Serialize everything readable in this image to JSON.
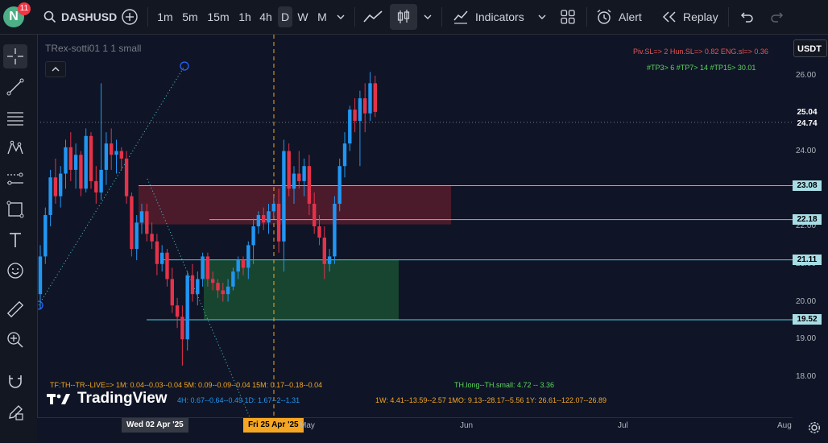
{
  "topbar": {
    "avatar_letter": "N",
    "notif_count": "11",
    "symbol": "DASHUSD",
    "timeframes": [
      "1m",
      "5m",
      "15m",
      "1h",
      "4h",
      "D",
      "W",
      "M"
    ],
    "active_timeframe": "D",
    "indicators_label": "Indicators",
    "alert_label": "Alert",
    "replay_label": "Replay"
  },
  "chart": {
    "indicator_title": "TRex-sotti01 1 1 small",
    "currency": "USDT",
    "top_info_1": "Piv.SL=> 2  Hun.SL=> 0.82  ENG.sl=> 0.36",
    "top_info_2": "#TP3> 6  #TP7> 14  #TP15> 30.01",
    "price_scale": [
      "26.00",
      "25.00",
      "24.00",
      "23.00",
      "22.00",
      "21.00",
      "20.00",
      "19.00",
      "18.00"
    ],
    "price_tags": [
      {
        "text": "25.04",
        "color": "#0f1526",
        "fg": "#ffffff"
      },
      {
        "text": "24.74",
        "color": "#0f1526",
        "fg": "#ffffff"
      },
      {
        "text": "23.08",
        "color": "#a8dde6",
        "fg": "#000000"
      },
      {
        "text": "22.18",
        "color": "#a8dde6",
        "fg": "#000000"
      },
      {
        "text": "21.11",
        "color": "#a8dde6",
        "fg": "#000000"
      },
      {
        "text": "19.52",
        "color": "#a8dde6",
        "fg": "#000000"
      }
    ],
    "time_labels": {
      "date_1": "Wed 02 Apr '25",
      "date_2": "Fri 25 Apr '25",
      "may": "May",
      "jun": "Jun",
      "jul": "Jul",
      "aug": "Aug"
    },
    "bottom_info": {
      "row1_a": "TF:TH--TR--LIVE=>  1M: 0.04--0.03--0.04   5M: 0.09--0.09--0.04   15M: 0.17--0.18--0.04",
      "row1_b": "TH.long--TH.small: 4.72 -- 3.36",
      "row2_a": "4H: 0.67--0.64--0.49   1D: 1.67--2--1.31",
      "row2_b": "1W: 4.41--13.59--2.57   1MO: 9.13--28.17--5.56   1Y: 26.61--122.07--26.89"
    },
    "watermark": "TradingView",
    "colors": {
      "bull": "#2196f3",
      "bear": "#e5324a",
      "level": "#4dd0e1",
      "orange": "#f5a623",
      "green_info": "#5cd65c",
      "red_info": "#ef5350"
    }
  },
  "chart_data": {
    "type": "candlestick",
    "candles": [
      [
        0,
        20.2,
        21.5,
        19.8,
        21.2
      ],
      [
        1,
        21.2,
        22.5,
        21.0,
        22.3
      ],
      [
        2,
        22.3,
        23.5,
        22.0,
        23.3
      ],
      [
        3,
        23.3,
        23.8,
        22.6,
        22.8
      ],
      [
        4,
        22.8,
        23.6,
        22.5,
        23.4
      ],
      [
        5,
        23.4,
        24.3,
        23.0,
        24.1
      ],
      [
        6,
        24.1,
        24.5,
        23.2,
        23.5
      ],
      [
        7,
        23.5,
        24.2,
        23.0,
        23.9
      ],
      [
        8,
        23.9,
        24.0,
        22.8,
        23.0
      ],
      [
        9,
        23.0,
        24.6,
        22.9,
        24.4
      ],
      [
        10,
        24.4,
        24.5,
        23.0,
        23.2
      ],
      [
        11,
        23.2,
        23.6,
        22.6,
        22.9
      ],
      [
        12,
        22.9,
        25.8,
        22.7,
        23.5
      ],
      [
        13,
        23.5,
        24.5,
        23.1,
        24.2
      ],
      [
        14,
        24.2,
        24.6,
        23.5,
        23.9
      ],
      [
        15,
        23.9,
        24.3,
        23.4,
        24.0
      ],
      [
        16,
        24.0,
        24.1,
        23.5,
        23.8
      ],
      [
        17,
        23.8,
        24.0,
        22.6,
        22.8
      ],
      [
        18,
        22.8,
        22.9,
        21.2,
        21.4
      ],
      [
        19,
        21.4,
        22.3,
        21.1,
        22.1
      ],
      [
        20,
        22.1,
        22.6,
        21.8,
        22.4
      ],
      [
        21,
        22.4,
        22.6,
        21.6,
        21.8
      ],
      [
        22,
        21.8,
        22.1,
        21.4,
        21.6
      ],
      [
        23,
        21.6,
        21.8,
        20.7,
        21.0
      ],
      [
        24,
        21.0,
        21.5,
        20.8,
        21.3
      ],
      [
        25,
        21.3,
        21.4,
        20.4,
        20.6
      ],
      [
        26,
        20.6,
        20.9,
        19.7,
        19.9
      ],
      [
        27,
        19.9,
        20.1,
        19.3,
        19.6
      ],
      [
        28,
        19.6,
        19.9,
        18.3,
        19.0
      ],
      [
        29,
        19.0,
        20.8,
        18.7,
        20.7
      ],
      [
        30,
        20.7,
        21.0,
        20.0,
        20.2
      ],
      [
        31,
        20.2,
        20.8,
        19.9,
        20.6
      ],
      [
        32,
        20.6,
        21.3,
        20.4,
        21.2
      ],
      [
        33,
        21.2,
        21.3,
        20.4,
        20.6
      ],
      [
        34,
        20.6,
        20.8,
        20.3,
        20.5
      ],
      [
        35,
        20.5,
        20.6,
        20.1,
        20.3
      ],
      [
        36,
        20.3,
        20.5,
        20.0,
        20.2
      ],
      [
        37,
        20.2,
        20.6,
        20.0,
        20.4
      ],
      [
        38,
        20.4,
        20.9,
        20.3,
        20.8
      ],
      [
        39,
        20.8,
        21.2,
        20.6,
        21.1
      ],
      [
        40,
        21.1,
        21.2,
        20.7,
        20.9
      ],
      [
        41,
        20.9,
        21.6,
        20.6,
        21.5
      ],
      [
        42,
        21.5,
        22.2,
        21.0,
        22.0
      ],
      [
        43,
        22.0,
        22.4,
        21.8,
        22.3
      ],
      [
        44,
        22.3,
        22.5,
        21.9,
        22.1
      ],
      [
        45,
        22.1,
        22.6,
        21.8,
        22.4
      ],
      [
        46,
        22.4,
        22.8,
        22.2,
        22.6
      ],
      [
        47,
        22.6,
        23.0,
        21.3,
        21.6
      ],
      [
        48,
        21.6,
        24.3,
        20.8,
        24.0
      ],
      [
        49,
        24.0,
        24.2,
        22.8,
        23.0
      ],
      [
        50,
        23.0,
        23.6,
        22.6,
        23.4
      ],
      [
        51,
        23.4,
        24.0,
        23.0,
        23.2
      ],
      [
        52,
        23.2,
        23.8,
        22.8,
        23.6
      ],
      [
        53,
        23.6,
        23.9,
        22.3,
        22.6
      ],
      [
        54,
        22.6,
        22.9,
        21.8,
        22.0
      ],
      [
        55,
        22.0,
        22.3,
        21.5,
        21.7
      ],
      [
        56,
        21.7,
        22.0,
        20.6,
        21.0
      ],
      [
        57,
        21.0,
        21.4,
        20.8,
        21.2
      ],
      [
        58,
        21.2,
        22.8,
        21.0,
        22.6
      ],
      [
        59,
        22.6,
        23.8,
        22.4,
        23.6
      ],
      [
        60,
        23.6,
        24.5,
        23.3,
        24.2
      ],
      [
        61,
        24.2,
        25.2,
        24.0,
        25.1
      ],
      [
        62,
        25.1,
        25.4,
        24.5,
        24.8
      ],
      [
        63,
        24.8,
        25.6,
        23.6,
        25.4
      ],
      [
        64,
        25.4,
        25.8,
        24.5,
        25.0
      ],
      [
        65,
        25.0,
        26.1,
        24.8,
        25.8
      ],
      [
        66,
        25.8,
        26.0,
        24.9,
        25.04
      ]
    ],
    "levels": [
      23.08,
      22.18,
      21.11,
      19.52
    ],
    "ylim": [
      17.5,
      26.5
    ]
  }
}
